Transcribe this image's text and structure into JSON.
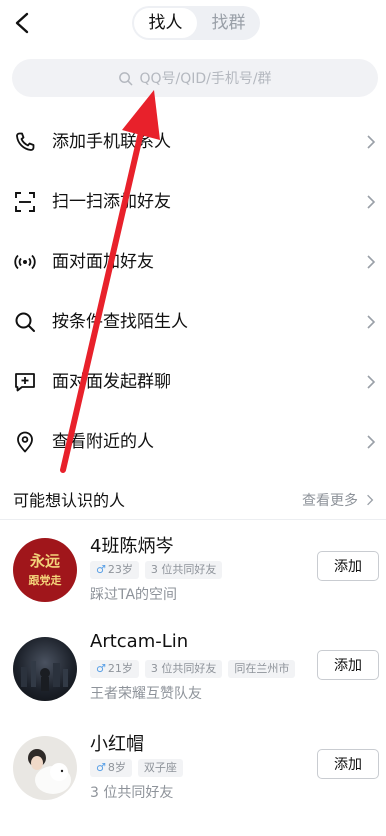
{
  "header": {
    "tab_people": "找人",
    "tab_groups": "找群"
  },
  "search": {
    "placeholder": "QQ号/QID/手机号/群"
  },
  "menu": [
    {
      "label": "添加手机联系人",
      "icon": "phone-icon"
    },
    {
      "label": "扫一扫添加好友",
      "icon": "scan-icon"
    },
    {
      "label": "面对面加好友",
      "icon": "broadcast-icon"
    },
    {
      "label": "按条件查找陌生人",
      "icon": "search-icon"
    },
    {
      "label": "面对面发起群聊",
      "icon": "chat-add-icon"
    },
    {
      "label": "查看附近的人",
      "icon": "location-icon"
    }
  ],
  "suggestions": {
    "title": "可能想认识的人",
    "see_more": "查看更多",
    "people": [
      {
        "name": "4班陈炳岑",
        "tags": [
          "23岁",
          "3 位共同好友"
        ],
        "desc": "踩过TA的空间",
        "add_label": "添加",
        "avatar_text": [
          "永远",
          "跟党走"
        ]
      },
      {
        "name": "Artcam-Lin",
        "tags": [
          "21岁",
          "3 位共同好友",
          "同在兰州市"
        ],
        "desc": "王者荣耀互赞队友",
        "add_label": "添加"
      },
      {
        "name": "小红帽",
        "tags": [
          "8岁",
          "双子座"
        ],
        "desc": "3 位共同好友",
        "add_label": "添加"
      }
    ]
  },
  "colors": {
    "accent_male": "#5aa0e6",
    "arrow": "#e8212b"
  }
}
